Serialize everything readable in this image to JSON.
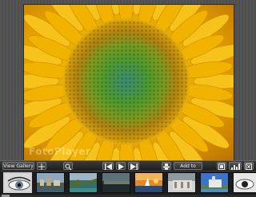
{
  "watermark": "FotoPlayer",
  "toolbar": {
    "view_gallery_label": "View Gallery",
    "add_to_cart_label": "Add to Cart"
  },
  "filmstrip": {
    "selected_index": 0,
    "thumb_count": 9
  },
  "colors": {
    "toolbar_bg": "#2a2a2a",
    "filmstrip_bg": "#1c1c1c",
    "petal": "#f2b400",
    "center_green": "#4f8f2c"
  },
  "icons": [
    "move-icon",
    "zoom-icon",
    "first-icon",
    "play-icon",
    "last-icon",
    "print-icon",
    "fullscreen-icon",
    "histogram-icon",
    "close-icon"
  ]
}
